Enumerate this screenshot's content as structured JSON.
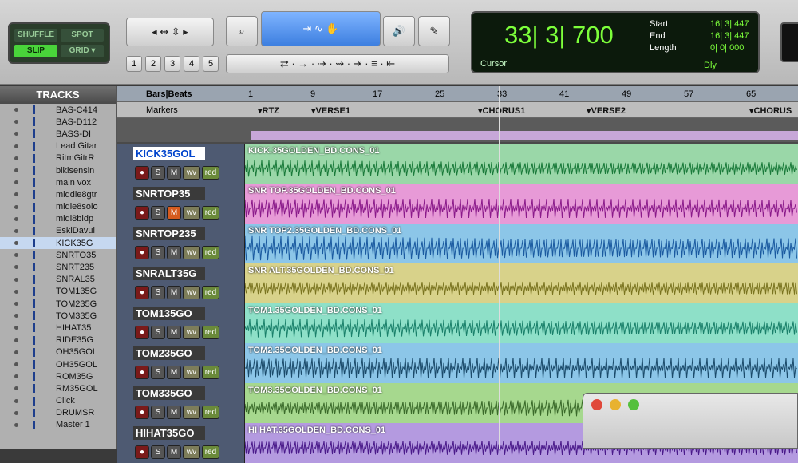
{
  "modes": {
    "shuffle": "SHUFFLE",
    "spot": "SPOT",
    "slip": "SLIP",
    "grid": "GRID ▾"
  },
  "zoom_presets": [
    "1",
    "2",
    "3",
    "4",
    "5"
  ],
  "counter": {
    "main": "33| 3| 700",
    "cursor_label": "Cursor",
    "start_label": "Start",
    "end_label": "End",
    "length_label": "Length",
    "start": "16| 3| 447",
    "end": "16| 3| 447",
    "length": "0| 0| 000",
    "dly": "Dly"
  },
  "tracks_panel_title": "TRACKS",
  "track_list": [
    "BAS-C414",
    "BAS-D112",
    "BASS-DI",
    "Lead Gitar",
    "RitmGitrR",
    "bikisensin",
    "main vox",
    "middle8gtr",
    "midle8solo",
    "midl8bldp",
    "EskiDavul",
    "KICK35G",
    "SNRTO35",
    "SNRT235",
    "SNRAL35",
    "TOM135G",
    "TOM235G",
    "TOM335G",
    "HIHAT35",
    "RIDE35G",
    "OH35GOL",
    "OH35GOL",
    "ROM35G",
    "RM35GOL",
    "Click",
    "DRUMSR",
    "Master 1"
  ],
  "ruler": {
    "label": "Bars|Beats",
    "markers_label": "Markers",
    "ticks": [
      "1",
      "9",
      "17",
      "25",
      "33",
      "41",
      "49",
      "57",
      "65"
    ]
  },
  "markers": [
    "RTZ",
    "VERSE1",
    "CHORUS1",
    "VERSE2",
    "CHORUS"
  ],
  "edit_tracks": [
    {
      "name": "KICK35GOL",
      "clip": "KICK.35GOLDEN_BD.CONS_01",
      "color": "#9ad7a8",
      "wave": "#1a7a3a",
      "mute_on": false
    },
    {
      "name": "SNRTOP35",
      "clip": "SNR TOP.35GOLDEN_BD.CONS_01",
      "color": "#e79ad7",
      "wave": "#8a1a8a",
      "mute_on": true
    },
    {
      "name": "SNRTOP235",
      "clip": "SNR TOP2.35GOLDEN_BD.CONS_01",
      "color": "#8cc6e8",
      "wave": "#1a5aa0",
      "mute_on": false
    },
    {
      "name": "SNRALT35G",
      "clip": "SNR ALT.35GOLDEN_BD.CONS_01",
      "color": "#d8d28a",
      "wave": "#7a7420",
      "mute_on": false
    },
    {
      "name": "TOM135GO",
      "clip": "TOM1.35GOLDEN_BD.CONS_01",
      "color": "#8ee0c8",
      "wave": "#1a806a",
      "mute_on": false
    },
    {
      "name": "TOM235GO",
      "clip": "TOM2.35GOLDEN_BD.CONS_01",
      "color": "#8cc6e8",
      "wave": "#1a4a6a",
      "mute_on": false
    },
    {
      "name": "TOM335GO",
      "clip": "TOM3.35GOLDEN_BD.CONS_01",
      "color": "#a6d88e",
      "wave": "#3a6a2a",
      "mute_on": false
    },
    {
      "name": "HIHAT35GO",
      "clip": "HI HAT.35GOLDEN_BD.CONS_01",
      "color": "#b49ae0",
      "wave": "#4a1a8a",
      "mute_on": false
    }
  ],
  "track_buttons": {
    "rec": "●",
    "solo": "S",
    "mute": "M",
    "wave": "wv",
    "red": "red"
  }
}
